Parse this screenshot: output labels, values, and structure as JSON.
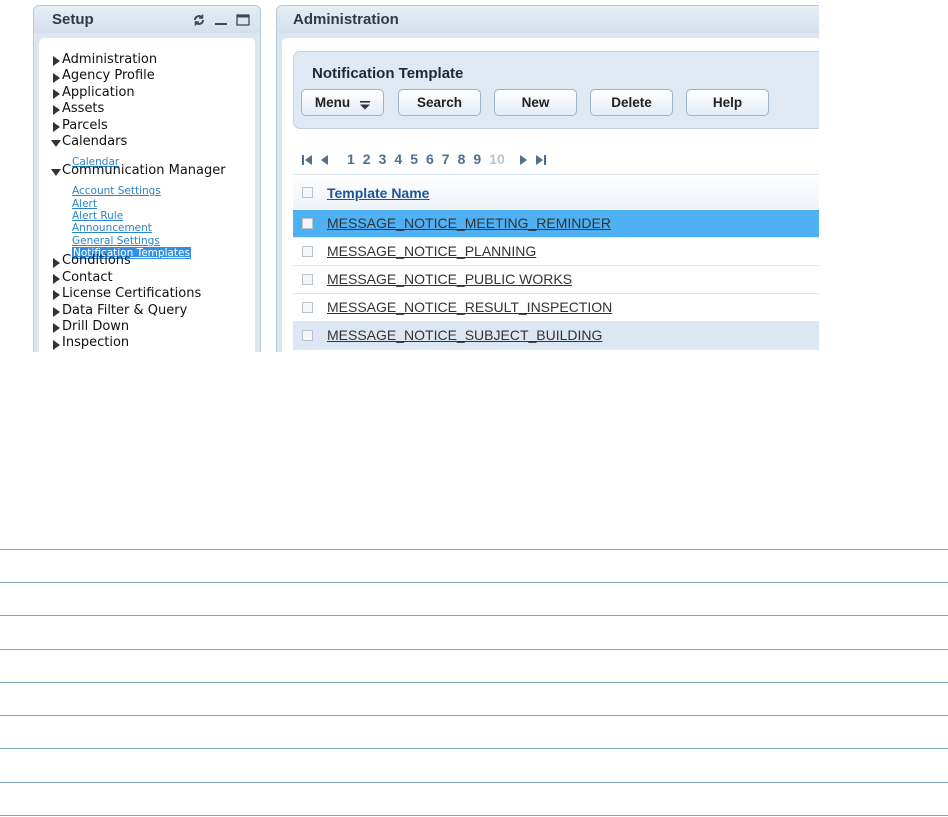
{
  "setup": {
    "title": "Setup",
    "header_icons": [
      "refresh-icon",
      "minimize-icon",
      "maximize-icon"
    ],
    "tree": [
      {
        "label": "Administration",
        "expanded": false
      },
      {
        "label": "Agency Profile",
        "expanded": false
      },
      {
        "label": "Application",
        "expanded": false
      },
      {
        "label": "Assets",
        "expanded": false
      },
      {
        "label": "Parcels",
        "expanded": false
      },
      {
        "label": "Calendars",
        "expanded": true,
        "children": [
          {
            "label": "Calendar"
          }
        ]
      },
      {
        "label": "Communication Manager",
        "expanded": true,
        "children": [
          {
            "label": "Account Settings"
          },
          {
            "label": "Alert"
          },
          {
            "label": "Alert Rule"
          },
          {
            "label": "Announcement"
          },
          {
            "label": "General Settings"
          },
          {
            "label": "Notification Templates",
            "selected": true
          }
        ]
      },
      {
        "label": "Conditions",
        "expanded": false
      },
      {
        "label": "Contact",
        "expanded": false
      },
      {
        "label": "License Certifications",
        "expanded": false
      },
      {
        "label": "Data Filter & Query",
        "expanded": false
      },
      {
        "label": "Drill Down",
        "expanded": false
      },
      {
        "label": "Inspection",
        "expanded": false
      }
    ]
  },
  "admin": {
    "title": "Administration",
    "section_title": "Notification Template",
    "buttons": {
      "menu": "Menu",
      "search": "Search",
      "new": "New",
      "delete": "Delete",
      "help": "Help"
    },
    "pager": {
      "pages": [
        "1",
        "2",
        "3",
        "4",
        "5",
        "6",
        "7",
        "8",
        "9",
        "10"
      ],
      "disabled_page": "10"
    },
    "grid": {
      "column_header": "Template Name",
      "rows": [
        {
          "name": "MESSAGE_NOTICE_MEETING_REMINDER",
          "state": "selected"
        },
        {
          "name": "MESSAGE_NOTICE_PLANNING",
          "state": "normal"
        },
        {
          "name": "MESSAGE_NOTICE_PUBLIC WORKS",
          "state": "normal"
        },
        {
          "name": "MESSAGE_NOTICE_RESULT_INSPECTION",
          "state": "normal"
        },
        {
          "name": "MESSAGE_NOTICE_SUBJECT_BUILDING",
          "state": "hover"
        }
      ]
    }
  },
  "colors": {
    "selected_row": "#4fb1f4",
    "hover_row": "#dbe8f4",
    "tree_link": "#2a84c6",
    "rule_line": "#7fa3b7"
  }
}
